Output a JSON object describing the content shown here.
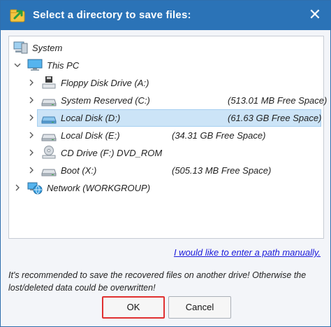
{
  "titlebar": {
    "title": "Select a directory to save files:",
    "close_glyph": "✕",
    "icon": "folder-arrow-icon"
  },
  "tree": {
    "items": [
      {
        "label": "System",
        "icon": "system-computer-icon",
        "space": ""
      },
      {
        "label": "This PC",
        "icon": "monitor-icon",
        "space": ""
      },
      {
        "label": "Floppy Disk Drive (A:)",
        "icon": "floppy-drive-icon",
        "space": ""
      },
      {
        "label": "System Reserved (C:)",
        "icon": "hard-drive-icon",
        "space": "(513.01 MB Free Space)"
      },
      {
        "label": "Local Disk (D:)",
        "icon": "hard-drive-icon",
        "space": "(61.63 GB Free Space)"
      },
      {
        "label": "Local Disk (E:)",
        "icon": "hard-drive-icon",
        "space": "(34.31 GB Free Space)"
      },
      {
        "label": "CD Drive (F:) DVD_ROM",
        "icon": "cd-drive-icon",
        "space": ""
      },
      {
        "label": "Boot (X:)",
        "icon": "hard-drive-icon",
        "space": "(505.13 MB Free Space)"
      },
      {
        "label": "Network (WORKGROUP)",
        "icon": "network-globe-icon",
        "space": ""
      }
    ],
    "selected_label": "Local Disk (D:)"
  },
  "manual_link": "I would like to enter a path manually.",
  "note": "It's recommended to save the recovered files on another drive! Otherwise the lost/deleted data could be overwritten!",
  "buttons": {
    "ok": "OK",
    "cancel": "Cancel"
  },
  "colors": {
    "titlebar": "#2b73b7",
    "selection": "#cce4f7",
    "ok_highlight": "#e03030",
    "link": "#1a1adb"
  }
}
